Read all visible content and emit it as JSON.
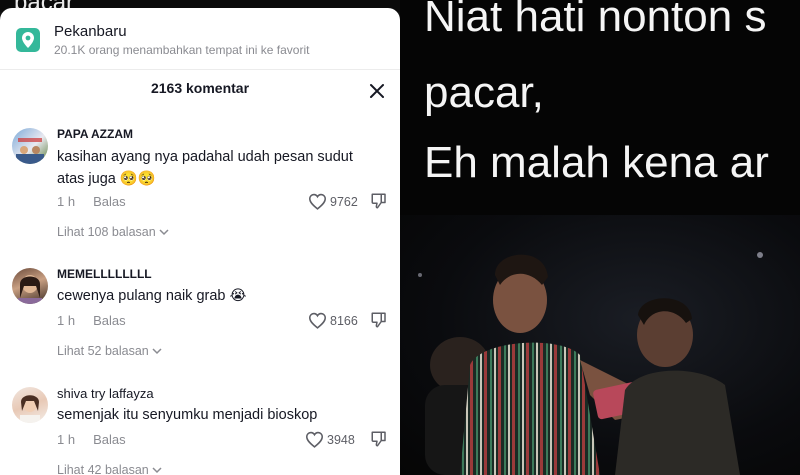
{
  "location": {
    "name": "Pekanbaru",
    "subtitle": "20.1K orang menambahkan tempat ini ke favorit"
  },
  "comments_header": "2163 komentar",
  "comments": [
    {
      "username": "PAPA AZZAM",
      "text": "kasihan ayang nya padahal udah pesan sudut atas juga 🥺🥺",
      "time": "1 h",
      "reply_label": "Balas",
      "likes": "9762",
      "more_replies": "Lihat 108 balasan"
    },
    {
      "username": "MEMELLLLLLLL",
      "text": "cewenya pulang naik grab 😭",
      "time": "1 h",
      "reply_label": "Balas",
      "likes": "8166",
      "more_replies": "Lihat 52 balasan"
    },
    {
      "username": "shiva try laffayza",
      "text": "semenjak itu senyumku menjadi bioskop",
      "time": "1 h",
      "reply_label": "Balas",
      "likes": "3948",
      "more_replies": "Lihat 42 balasan"
    }
  ],
  "video_caption": {
    "line1": "Niat hati nonton s",
    "line2": "pacar,",
    "line3": "Eh malah kena ar"
  },
  "top_strip_text": "pacar",
  "colors": {
    "location_icon": "#34b89a",
    "panel_bg": "#ffffff",
    "muted": "#8a8b91"
  },
  "icons": [
    "location-pin-icon",
    "close-icon",
    "heart-icon",
    "dislike-icon",
    "chevron-down-icon"
  ]
}
